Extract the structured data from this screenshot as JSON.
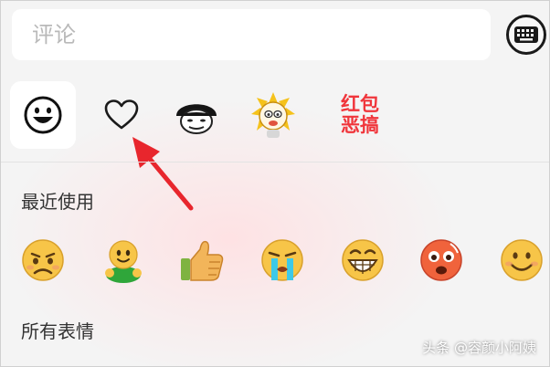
{
  "comment": {
    "placeholder": "评论"
  },
  "toolbar": {
    "keyboard_icon": "keyboard-icon"
  },
  "tabs": [
    {
      "id": "default",
      "icon": "smiley-face-icon",
      "active": true
    },
    {
      "id": "favorites",
      "icon": "heart-outline-icon",
      "active": false
    },
    {
      "id": "mushroom",
      "icon": "mushroom-head-sticker-icon",
      "active": false
    },
    {
      "id": "meme",
      "icon": "cartoon-meme-sticker-icon",
      "active": false
    },
    {
      "id": "redpacket",
      "label": "红包恶搞",
      "color": "#f0353b",
      "active": false
    }
  ],
  "recent": {
    "title": "最近使用",
    "emojis": [
      "sad-face-icon",
      "green-figure-icon",
      "thumbs-up-icon",
      "crying-face-icon",
      "grinning-face-icon",
      "flushed-face-icon",
      "smiling-face-icon"
    ]
  },
  "all": {
    "title": "所有表情"
  },
  "watermark": "头条 @容颜小阿姨",
  "colors": {
    "annotation_arrow": "#e8262d",
    "accent_red": "#f0353b"
  }
}
